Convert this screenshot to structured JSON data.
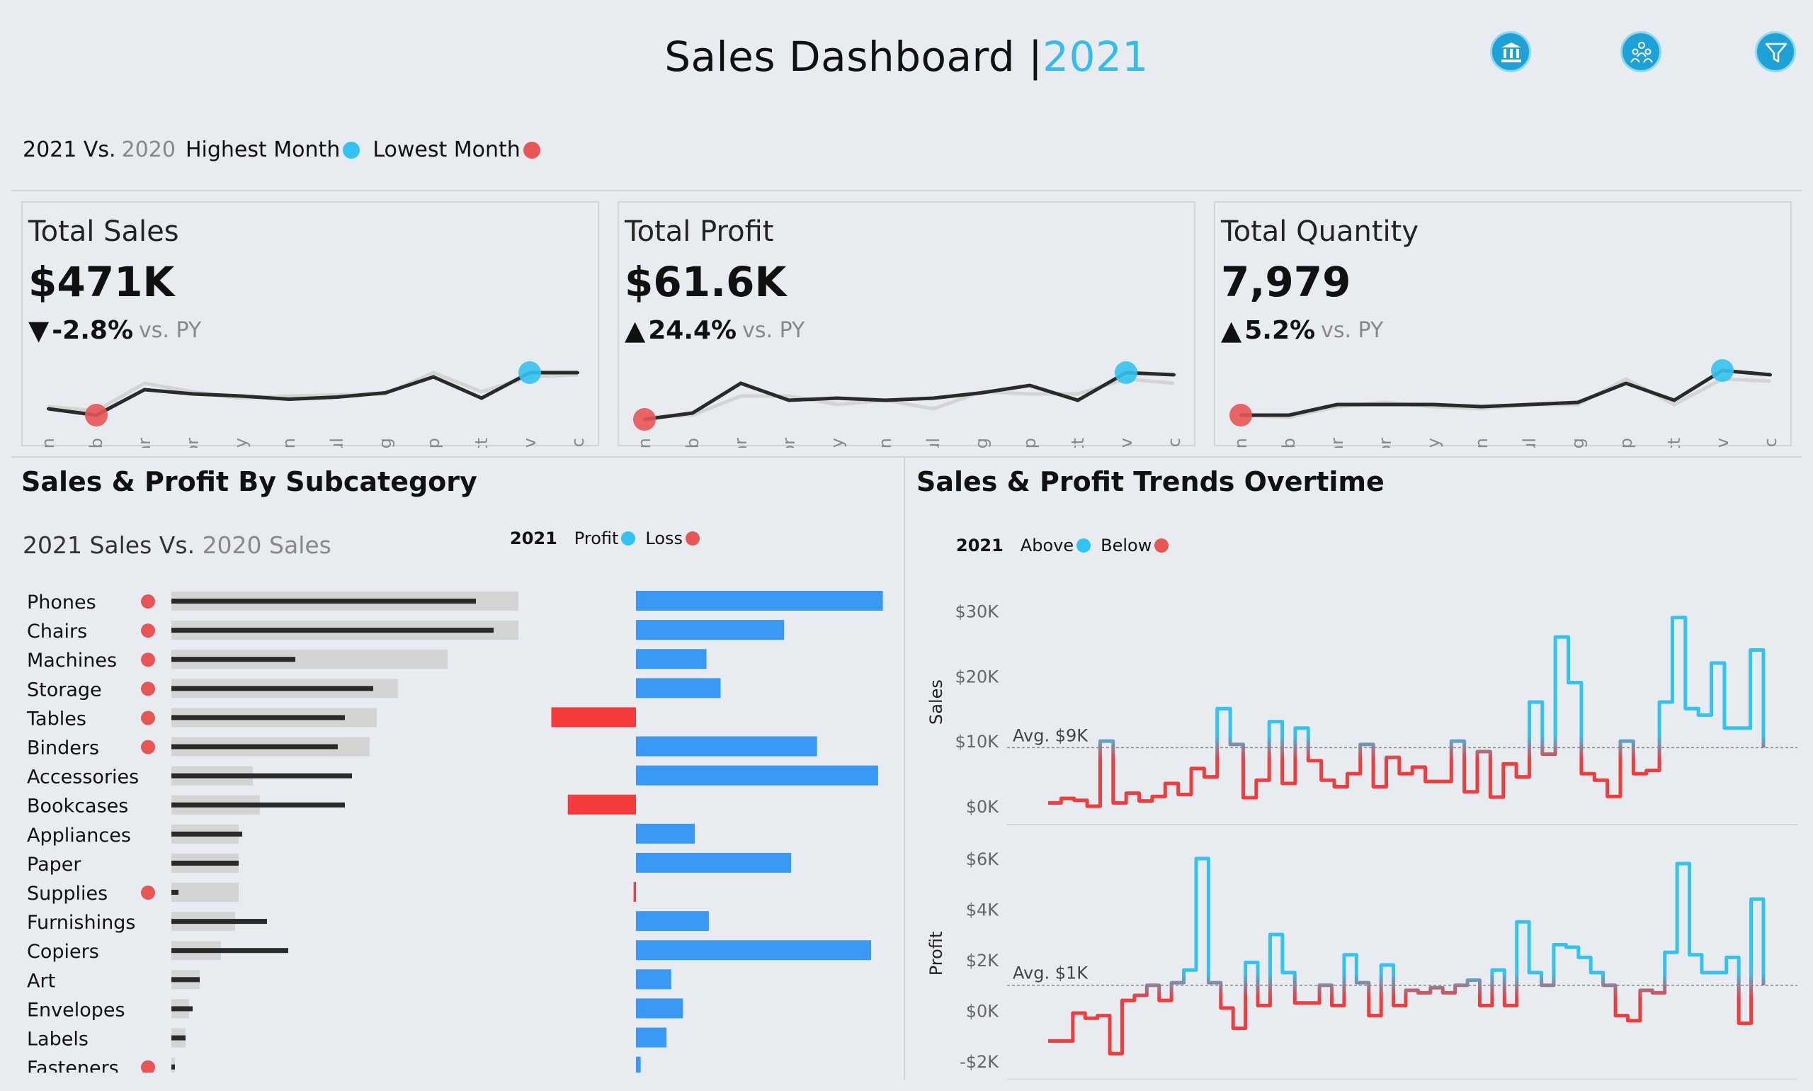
{
  "header": {
    "title": "Sales Dashboard |",
    "year": "2021",
    "icons": [
      "bank-icon",
      "people-icon",
      "filter-icon"
    ]
  },
  "legend": {
    "current": "2021 Vs.",
    "previous": "2020",
    "highest": "Highest Month",
    "lowest": "Lowest Month"
  },
  "colors": {
    "accent": "#33bdee",
    "high": "#33c3f0",
    "low": "#e85555",
    "profit_bar": "#3a99f5",
    "loss_bar": "#f53b3b",
    "line_dark": "#2a2a2a",
    "line_light": "#d4d4d4"
  },
  "months": [
    "Jan",
    "Feb",
    "Mar",
    "Apr",
    "May",
    "Jun",
    "Jul",
    "Aug",
    "Sep",
    "Oct",
    "Nov",
    "Dec"
  ],
  "kpis": [
    {
      "label": "Total Sales",
      "value": "$471K",
      "arrow": "▼",
      "change": "-2.8%",
      "vs": "vs. PY",
      "current": [
        18,
        12,
        36,
        32,
        30,
        27,
        29,
        33,
        48,
        28,
        52,
        52
      ],
      "previous": [
        20,
        16,
        42,
        34,
        28,
        30,
        31,
        32,
        52,
        34,
        48,
        50
      ],
      "high_index": 10,
      "low_index": 1
    },
    {
      "label": "Total Profit",
      "value": "$61.6K",
      "arrow": "▲",
      "change": "24.4%",
      "vs": "vs. PY",
      "current": [
        8,
        14,
        42,
        26,
        28,
        26,
        28,
        33,
        40,
        26,
        52,
        50
      ],
      "previous": [
        10,
        12,
        30,
        30,
        22,
        26,
        18,
        34,
        32,
        32,
        46,
        42
      ],
      "high_index": 10,
      "low_index": 0
    },
    {
      "label": "Total Quantity",
      "value": "7,979",
      "arrow": "▲",
      "change": "5.2%",
      "vs": "vs. PY",
      "current": [
        12,
        12,
        22,
        22,
        22,
        20,
        22,
        24,
        42,
        26,
        54,
        50
      ],
      "previous": [
        12,
        10,
        20,
        24,
        20,
        18,
        22,
        22,
        46,
        22,
        46,
        44
      ],
      "high_index": 10,
      "low_index": 0
    }
  ],
  "subcategory": {
    "title": "Sales & Profit By Subcategory",
    "subtitle_current": "2021 Sales Vs.",
    "subtitle_previous": "2020 Sales",
    "legend_year": "2021",
    "legend_profit": "Profit",
    "legend_loss": "Loss",
    "chart_data": {
      "type": "bar",
      "categories": [
        "Phones",
        "Chairs",
        "Machines",
        "Storage",
        "Tables",
        "Binders",
        "Accessories",
        "Bookcases",
        "Appliances",
        "Paper",
        "Supplies",
        "Furnishings",
        "Copiers",
        "Art",
        "Envelopes",
        "Labels",
        "Fasteners"
      ],
      "series": [
        {
          "name": "2021",
          "values": [
            86,
            91,
            35,
            57,
            49,
            47,
            51,
            49,
            20,
            19,
            2,
            27,
            33,
            8,
            6,
            4,
            1
          ]
        },
        {
          "name": "2020",
          "values": [
            98,
            98,
            78,
            64,
            58,
            56,
            23,
            25,
            19,
            19,
            19,
            18,
            14,
            8,
            5,
            4,
            1
          ]
        },
        {
          "name": "Profit",
          "values": [
            10.5,
            6.3,
            3.0,
            3.6,
            -3.6,
            7.7,
            10.3,
            -2.9,
            2.5,
            6.6,
            -0.1,
            3.1,
            10.0,
            1.5,
            2.0,
            1.3,
            0.2
          ]
        }
      ],
      "below_2020": [
        "Phones",
        "Chairs",
        "Machines",
        "Storage",
        "Tables",
        "Binders",
        "Supplies",
        "Fasteners"
      ]
    }
  },
  "trends": {
    "title": "Sales & Profit Trends Overtime",
    "legend_year": "2021",
    "legend_above": "Above",
    "legend_below": "Below",
    "chart_data": [
      {
        "type": "line",
        "ylabel": "Sales",
        "yticks": [
          "$30K",
          "$20K",
          "$10K",
          "$0K"
        ],
        "ylim": [
          0,
          32000
        ],
        "avg": 9000,
        "avg_label": "Avg. $9K",
        "values": [
          500,
          1200,
          900,
          0,
          10000,
          500,
          2000,
          800,
          1500,
          3500,
          1800,
          5800,
          4500,
          15000,
          9500,
          1300,
          4000,
          13000,
          3500,
          12000,
          7000,
          4000,
          3000,
          5000,
          9500,
          3000,
          7500,
          5000,
          6000,
          3800,
          3800,
          10000,
          2200,
          8400,
          1400,
          6500,
          4500,
          16000,
          8000,
          26000,
          19000,
          5000,
          4000,
          1500,
          10000,
          5000,
          5500,
          16000,
          29000,
          15000,
          14000,
          22000,
          12000,
          12000,
          24000,
          9000
        ]
      },
      {
        "type": "line",
        "ylabel": "Profit",
        "yticks": [
          "$6K",
          "$4K",
          "$2K",
          "$0K",
          "-$2K"
        ],
        "ylim": [
          -2000,
          6500
        ],
        "avg": 1000,
        "avg_label": "Avg. $1K",
        "values": [
          -1200,
          -1200,
          -100,
          -300,
          -200,
          -1700,
          400,
          600,
          1000,
          400,
          1100,
          1600,
          6000,
          1100,
          100,
          -700,
          1900,
          200,
          3000,
          1500,
          300,
          300,
          1000,
          200,
          2200,
          1100,
          -200,
          1800,
          200,
          800,
          700,
          900,
          700,
          1000,
          1200,
          200,
          1600,
          200,
          3500,
          1500,
          1000,
          2600,
          2500,
          2100,
          1500,
          1000,
          -200,
          -400,
          800,
          700,
          2300,
          5800,
          2200,
          1500,
          1500,
          2100,
          -500,
          4400,
          1000
        ]
      }
    ]
  }
}
